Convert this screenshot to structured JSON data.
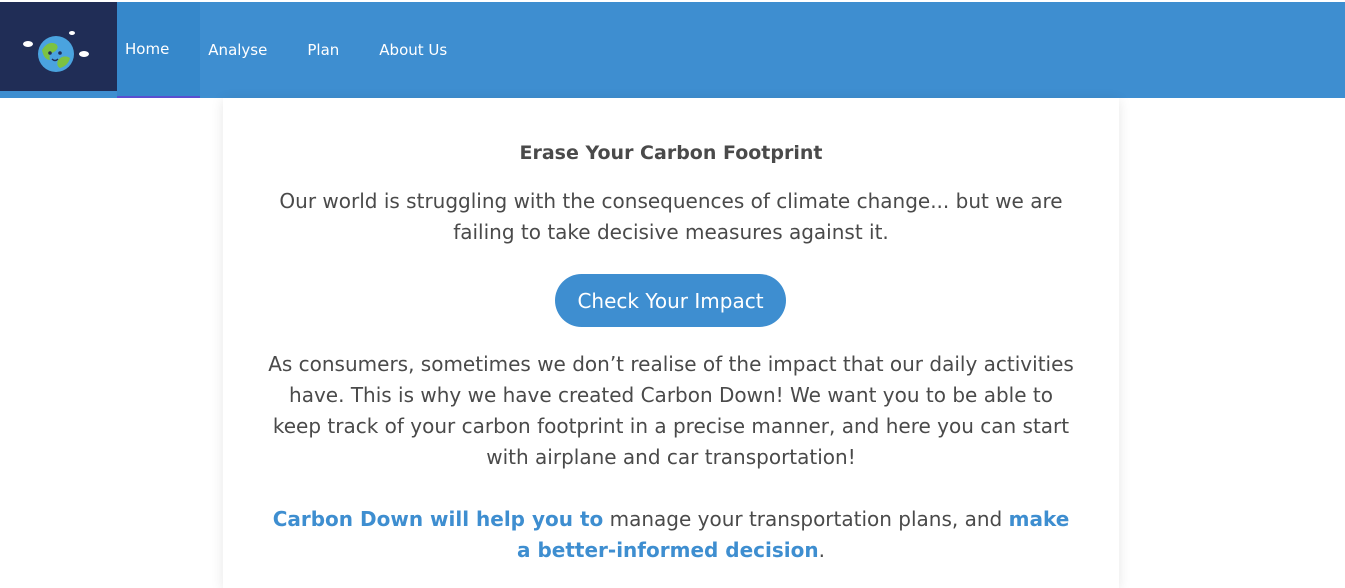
{
  "nav": {
    "logo_icon": "earth-icon",
    "items": [
      {
        "label": "Home",
        "active": true
      },
      {
        "label": "Analyse"
      },
      {
        "label": "Plan"
      },
      {
        "label": "About Us"
      }
    ]
  },
  "main": {
    "title": "Erase Your Carbon Footprint",
    "intro": "Our world is struggling with the consequences of climate change... but we are failing to take decisive measures against it.",
    "cta_label": "Check Your Impact",
    "body": "As consumers, sometimes we don’t realise of the impact that our daily activities have. This is why we have created Carbon Down! We want you to be able to keep track of your carbon footprint in a precise manner, and here you can start with airplane and car transportation!",
    "help": {
      "part1": "Carbon Down will help you to",
      "part2": " manage your transportation plans, and ",
      "part3": "make a better-informed decision",
      "part4": "."
    }
  },
  "colors": {
    "navbar": "#3e8ed0",
    "logo_bg": "#202d56",
    "accent": "#3e8ed0",
    "text": "#4a4a4a"
  }
}
